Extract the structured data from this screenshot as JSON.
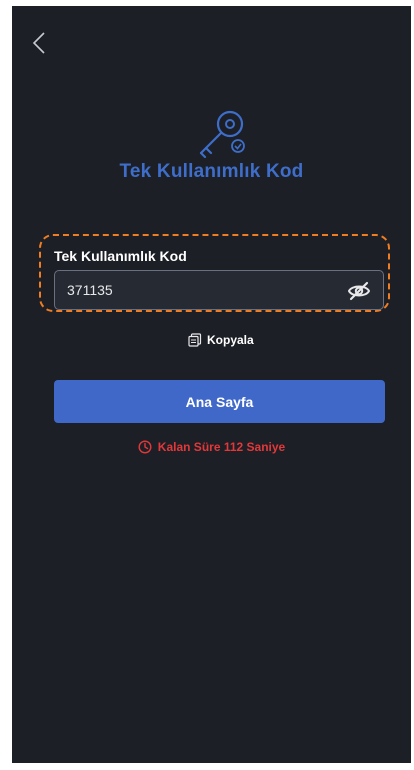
{
  "header": {
    "back_icon": "chevron-left-icon"
  },
  "hero": {
    "icon": "key-check-icon",
    "title": "Tek Kullanımlık Kod"
  },
  "code_field": {
    "label": "Tek Kullanımlık Kod",
    "value": "371135",
    "toggle_icon": "eye-off-icon"
  },
  "copy": {
    "icon": "copy-icon",
    "label": "Kopyala"
  },
  "primary_button": {
    "label": "Ana Sayfa"
  },
  "timer": {
    "icon": "clock-icon",
    "text": "Kalan Süre 112 Saniye"
  },
  "colors": {
    "background": "#1c1f26",
    "accent": "#4068c8",
    "title": "#3e6ec9",
    "highlight": "#f07d21",
    "warning": "#e2383a"
  }
}
